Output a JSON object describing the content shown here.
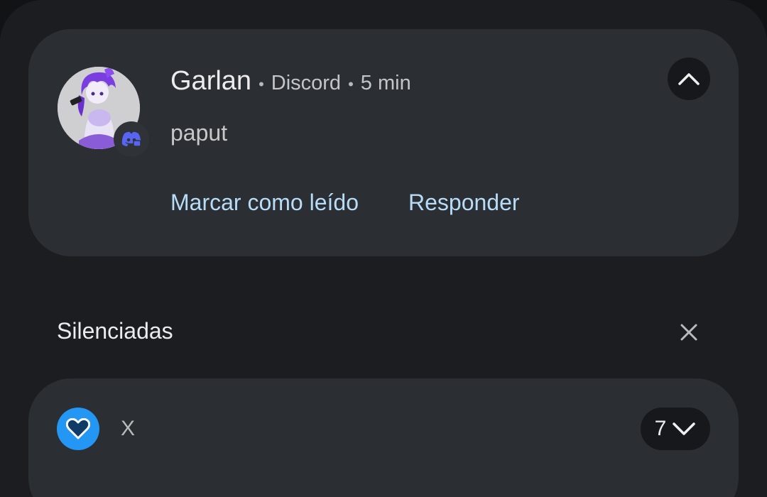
{
  "notification": {
    "sender": "Garlan",
    "separator": "•",
    "app": "Discord",
    "time": "5 min",
    "message": "paput",
    "actions": {
      "mark_read": "Marcar como leído",
      "reply": "Responder"
    },
    "avatar_icon": "anime-avatar",
    "badge_icon": "discord-icon",
    "badge_color": "#5865f2",
    "collapse_icon": "chevron-up-icon"
  },
  "silenced": {
    "title": "Silenciadas",
    "close_icon": "close-icon",
    "group": {
      "app_icon": "heart-icon",
      "app_color": "#2496f3",
      "app_name": "X",
      "count": "7",
      "expand_icon": "chevron-down-icon"
    }
  },
  "colors": {
    "background": "#1b1d20",
    "card": "#2b2e32",
    "accent_text": "#b6dcf7"
  }
}
